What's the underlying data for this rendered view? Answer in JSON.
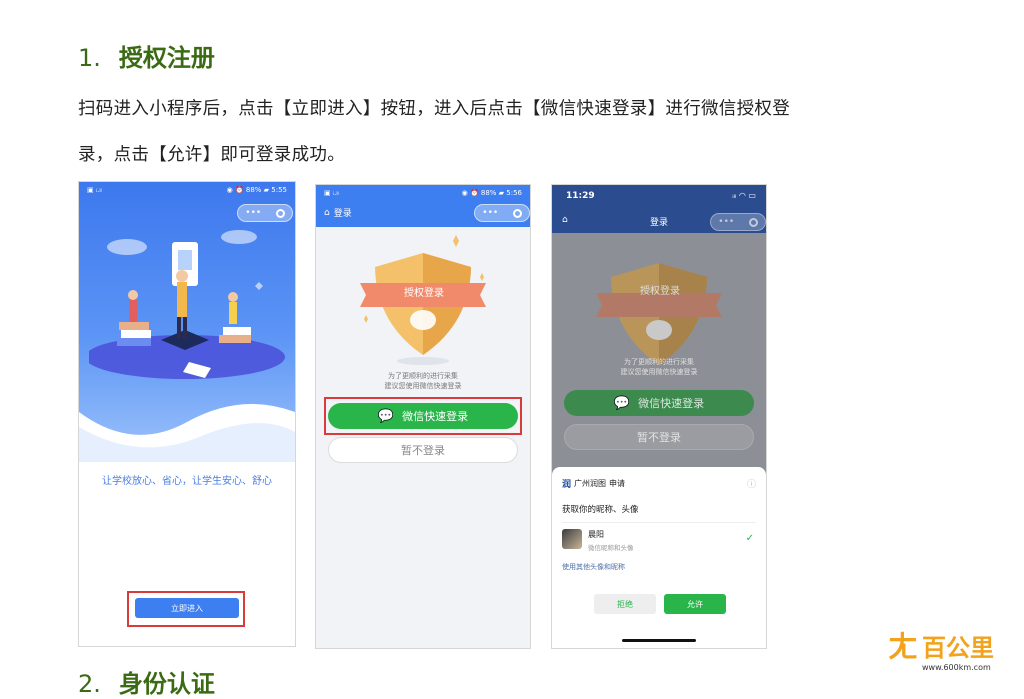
{
  "doc": {
    "heading1": {
      "number": "1.",
      "title": "授权注册"
    },
    "paragraph_line1": "扫码进入小程序后，点击【立即进入】按钮，进入后点击【微信快速登录】进行微信授权登",
    "paragraph_line2": "录，点击【允许】即可登录成功。",
    "heading2": {
      "number": "2.",
      "title": "身份认证"
    }
  },
  "phone1": {
    "status_left": "▣ ᵢ.ₗₗ",
    "status_right": "◉ ⏰ 88% ▰ 5:55",
    "slogan": "让学校放心、省心，让学生安心、舒心",
    "enter_button": "立即进入"
  },
  "phone2": {
    "status_left": "▣ ᵢ.ₗₗ",
    "status_right": "◉ ⏰ 88% ▰ 5:56",
    "nav_title": "登录",
    "shield_label": "授权登录",
    "notice_line1": "为了更顺利的进行采集",
    "notice_line2": "建议您使用微信快速登录",
    "wechat_login_button": "微信快速登录",
    "skip_button": "暂不登录"
  },
  "phone3": {
    "time": "11:29",
    "nav_title": "登录",
    "shield_label": "授权登录",
    "notice_line1": "为了更顺利的进行采集",
    "notice_line2": "建议您使用微信快速登录",
    "wechat_login_button": "微信快速登录",
    "skip_button": "暂不登录",
    "sheet": {
      "app_icon": "润",
      "app_name": "广州润图",
      "request": "申请",
      "permission": "获取你的昵称、头像",
      "user_name": "晨阳",
      "user_sub": "微信昵称和头像",
      "other_option": "使用其他头像和昵称",
      "reject_button": "拒绝",
      "allow_button": "允许"
    }
  },
  "watermark": {
    "brand": "百公里",
    "url": "www.600km.com"
  },
  "colors": {
    "heading": "#3a6b14",
    "primary_blue": "#3d7ef0",
    "wechat_green": "#2ab54b",
    "highlight_red": "#d93a3a",
    "watermark_orange": "#f2a21b"
  }
}
